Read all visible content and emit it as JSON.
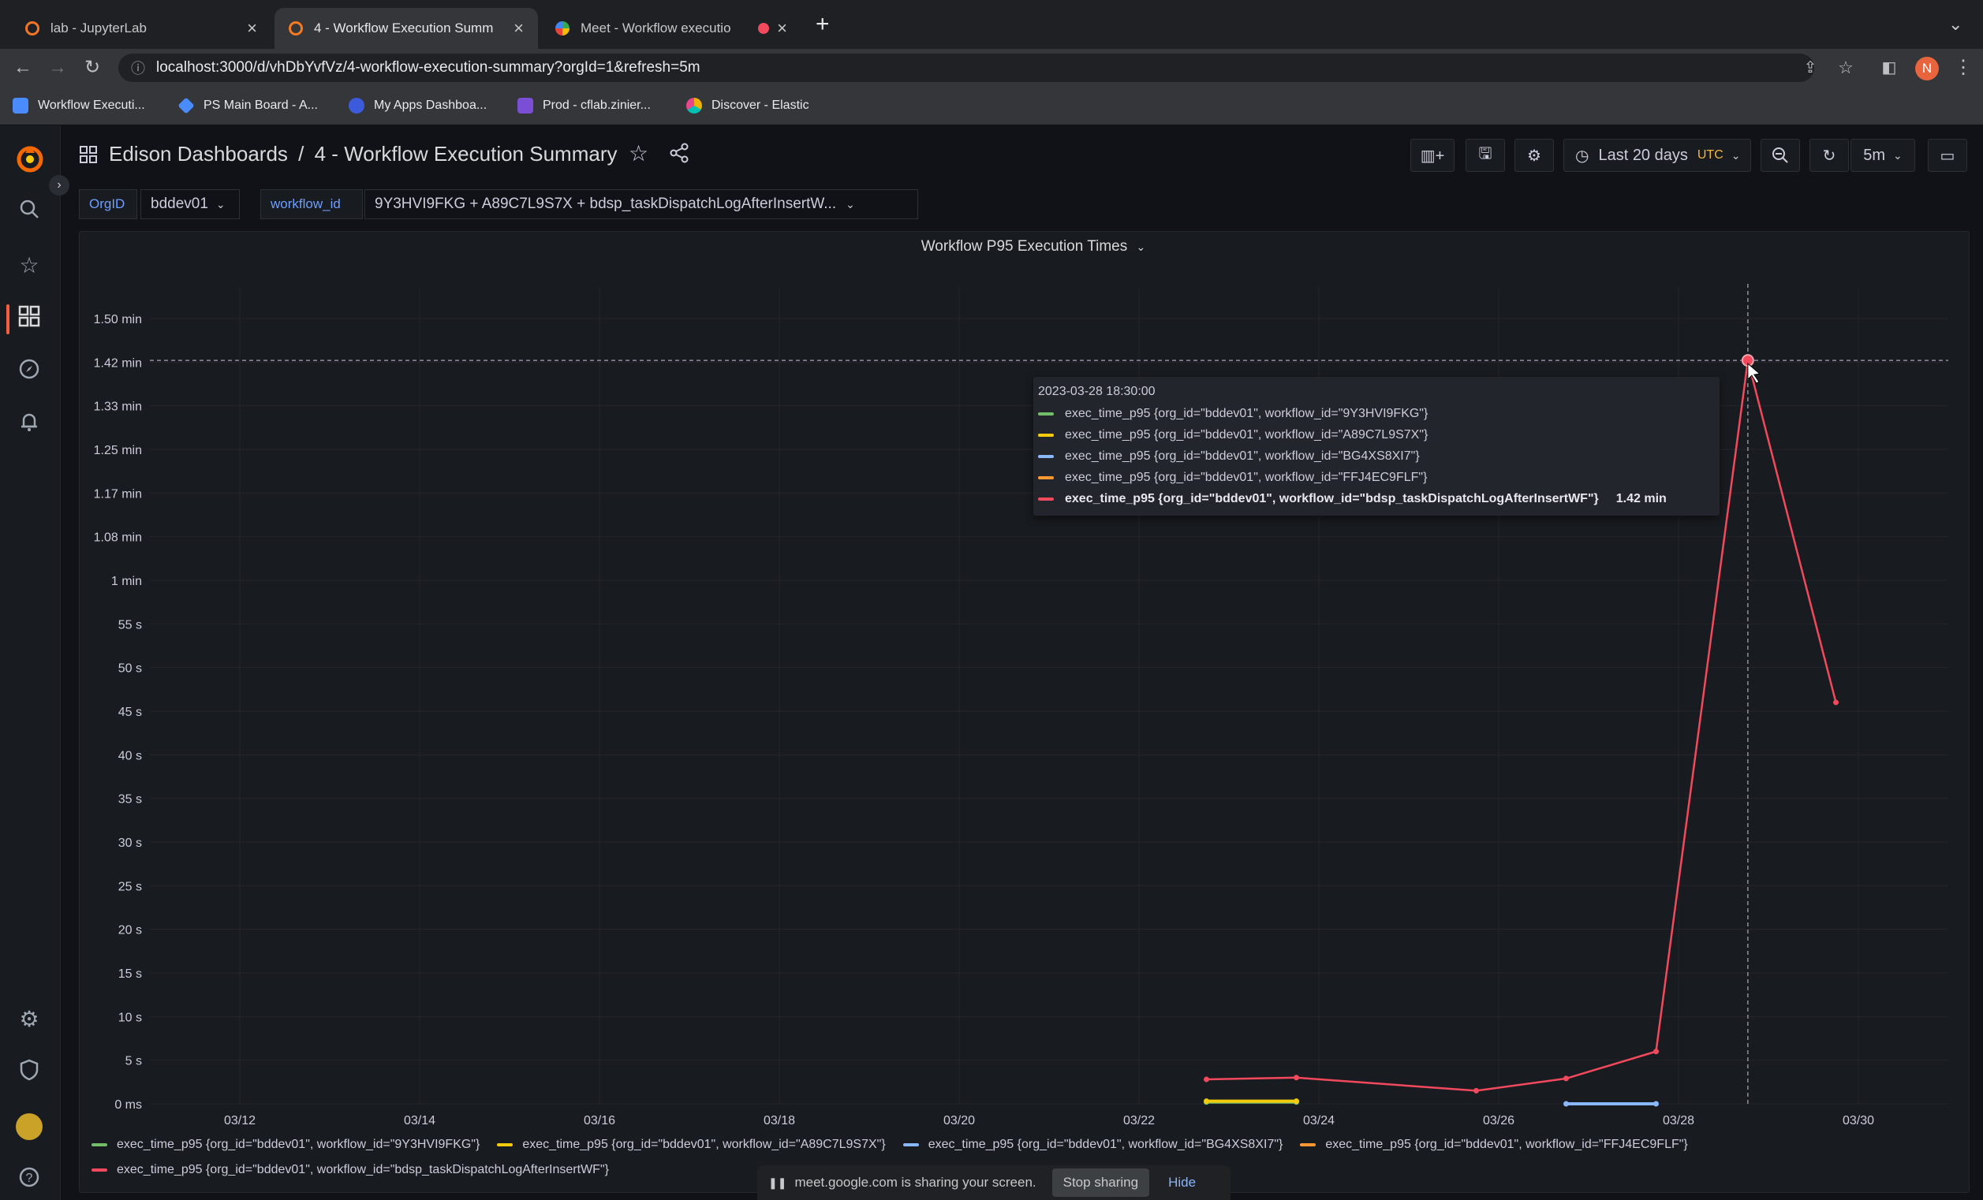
{
  "browser": {
    "tabs": [
      {
        "title": "lab - JupyterLab",
        "icon": "jupyter-icon"
      },
      {
        "title": "4 - Workflow Execution Summ",
        "icon": "grafana-icon"
      },
      {
        "title": "Meet - Workflow executio",
        "icon": "meet-icon"
      }
    ],
    "new_tab": "+",
    "url": "localhost:3000/d/vhDbYvfVz/4-workflow-execution-summary?orgId=1&refresh=5m",
    "profile_initial": "N",
    "bookmarks": [
      {
        "label": "Workflow Executi...",
        "color": "#4a8cff"
      },
      {
        "label": "PS Main Board - A...",
        "color": "#4a8cff"
      },
      {
        "label": "My Apps Dashboa...",
        "color": "#3b5bdb"
      },
      {
        "label": "Prod - cflab.zinier...",
        "color": "#7a4fd6"
      },
      {
        "label": "Discover - Elastic",
        "color": "#f0b400"
      }
    ]
  },
  "dashboard": {
    "folder": "Edison Dashboards",
    "separator": "/",
    "title": "4 - Workflow Execution Summary",
    "time_range": "Last 20 days",
    "timezone": "UTC",
    "refresh": "5m",
    "variables": [
      {
        "label": "OrgID",
        "value": "bddev01"
      },
      {
        "label": "workflow_id",
        "value": "9Y3HVI9FKG + A89C7L9S7X + bdsp_taskDispatchLogAfterInsertW..."
      }
    ]
  },
  "panel": {
    "title": "Workflow P95 Execution Times",
    "tooltip": {
      "time": "2023-03-28 18:30:00",
      "hovered_value": "1.42 min"
    }
  },
  "chart_data": {
    "type": "line",
    "title": "Workflow P95 Execution Times",
    "y_unit": "seconds",
    "ylim": [
      0,
      90
    ],
    "y_ticks": [
      0,
      5,
      10,
      15,
      20,
      25,
      30,
      35,
      40,
      45,
      50,
      55,
      60,
      65,
      70,
      75,
      80,
      85,
      90
    ],
    "y_tick_labels": [
      "0 ms",
      "5 s",
      "10 s",
      "15 s",
      "20 s",
      "25 s",
      "30 s",
      "35 s",
      "40 s",
      "45 s",
      "50 s",
      "55 s",
      "1 min",
      "1.08 min",
      "1.17 min",
      "1.25 min",
      "1.33 min",
      "1.42 min",
      "1.50 min"
    ],
    "xlim": [
      "2023-03-11",
      "2023-03-31"
    ],
    "x_tick_labels": [
      "03/12",
      "03/14",
      "03/16",
      "03/18",
      "03/20",
      "03/22",
      "03/24",
      "03/26",
      "03/28",
      "03/30"
    ],
    "x_ticks": [
      "2023-03-12",
      "2023-03-14",
      "2023-03-16",
      "2023-03-18",
      "2023-03-20",
      "2023-03-22",
      "2023-03-24",
      "2023-03-26",
      "2023-03-28",
      "2023-03-30"
    ],
    "hover_time": "2023-03-28 18:30",
    "grid": true,
    "legend_position": "bottom",
    "series": [
      {
        "name": "exec_time_p95 {org_id=\"bddev01\", workflow_id=\"9Y3HVI9FKG\"}",
        "color": "#73bf69",
        "points": [
          [
            "2023-03-22 18:00",
            0.2
          ],
          [
            "2023-03-23 18:00",
            0.2
          ]
        ]
      },
      {
        "name": "exec_time_p95 {org_id=\"bddev01\", workflow_id=\"A89C7L9S7X\"}",
        "color": "#f2cc0c",
        "points": [
          [
            "2023-03-22 18:00",
            0.3
          ],
          [
            "2023-03-23 18:00",
            0.3
          ]
        ]
      },
      {
        "name": "exec_time_p95 {org_id=\"bddev01\", workflow_id=\"BG4XS8XI7\"}",
        "color": "#8ab8ff",
        "points": [
          [
            "2023-03-26 18:00",
            0
          ],
          [
            "2023-03-27 18:00",
            0
          ]
        ]
      },
      {
        "name": "exec_time_p95 {org_id=\"bddev01\", workflow_id=\"FFJ4EC9FLF\"}",
        "color": "#ff9830",
        "points": []
      },
      {
        "name": "exec_time_p95 {org_id=\"bddev01\", workflow_id=\"bdsp_taskDispatchLogAfterInsertWF\"}",
        "color": "#f2495c",
        "points": [
          [
            "2023-03-22 18:00",
            2.8
          ],
          [
            "2023-03-23 18:00",
            3
          ],
          [
            "2023-03-25 18:00",
            1.5
          ],
          [
            "2023-03-26 18:00",
            2.9
          ],
          [
            "2023-03-27 18:00",
            6
          ],
          [
            "2023-03-28 18:30",
            85.2
          ],
          [
            "2023-03-29 18:00",
            46
          ]
        ]
      }
    ]
  },
  "share_bar": {
    "message": "meet.google.com is sharing your screen.",
    "stop": "Stop sharing",
    "hide": "Hide"
  },
  "icons": {
    "grafana_logo": "grafana-logo-icon",
    "sidebar": [
      "search-icon",
      "star-icon",
      "dashboards-icon",
      "explore-icon",
      "alerting-icon",
      "settings-icon",
      "shield-icon",
      "avatar-icon",
      "help-icon"
    ]
  }
}
